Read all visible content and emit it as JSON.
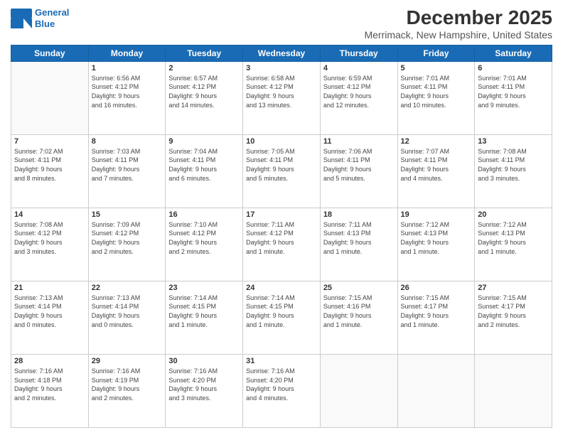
{
  "header": {
    "logo_line1": "General",
    "logo_line2": "Blue",
    "month": "December 2025",
    "location": "Merrimack, New Hampshire, United States"
  },
  "weekdays": [
    "Sunday",
    "Monday",
    "Tuesday",
    "Wednesday",
    "Thursday",
    "Friday",
    "Saturday"
  ],
  "weeks": [
    [
      {
        "day": "",
        "info": ""
      },
      {
        "day": "1",
        "info": "Sunrise: 6:56 AM\nSunset: 4:12 PM\nDaylight: 9 hours\nand 16 minutes."
      },
      {
        "day": "2",
        "info": "Sunrise: 6:57 AM\nSunset: 4:12 PM\nDaylight: 9 hours\nand 14 minutes."
      },
      {
        "day": "3",
        "info": "Sunrise: 6:58 AM\nSunset: 4:12 PM\nDaylight: 9 hours\nand 13 minutes."
      },
      {
        "day": "4",
        "info": "Sunrise: 6:59 AM\nSunset: 4:12 PM\nDaylight: 9 hours\nand 12 minutes."
      },
      {
        "day": "5",
        "info": "Sunrise: 7:01 AM\nSunset: 4:11 PM\nDaylight: 9 hours\nand 10 minutes."
      },
      {
        "day": "6",
        "info": "Sunrise: 7:01 AM\nSunset: 4:11 PM\nDaylight: 9 hours\nand 9 minutes."
      }
    ],
    [
      {
        "day": "7",
        "info": "Sunrise: 7:02 AM\nSunset: 4:11 PM\nDaylight: 9 hours\nand 8 minutes."
      },
      {
        "day": "8",
        "info": "Sunrise: 7:03 AM\nSunset: 4:11 PM\nDaylight: 9 hours\nand 7 minutes."
      },
      {
        "day": "9",
        "info": "Sunrise: 7:04 AM\nSunset: 4:11 PM\nDaylight: 9 hours\nand 6 minutes."
      },
      {
        "day": "10",
        "info": "Sunrise: 7:05 AM\nSunset: 4:11 PM\nDaylight: 9 hours\nand 5 minutes."
      },
      {
        "day": "11",
        "info": "Sunrise: 7:06 AM\nSunset: 4:11 PM\nDaylight: 9 hours\nand 5 minutes."
      },
      {
        "day": "12",
        "info": "Sunrise: 7:07 AM\nSunset: 4:11 PM\nDaylight: 9 hours\nand 4 minutes."
      },
      {
        "day": "13",
        "info": "Sunrise: 7:08 AM\nSunset: 4:11 PM\nDaylight: 9 hours\nand 3 minutes."
      }
    ],
    [
      {
        "day": "14",
        "info": "Sunrise: 7:08 AM\nSunset: 4:12 PM\nDaylight: 9 hours\nand 3 minutes."
      },
      {
        "day": "15",
        "info": "Sunrise: 7:09 AM\nSunset: 4:12 PM\nDaylight: 9 hours\nand 2 minutes."
      },
      {
        "day": "16",
        "info": "Sunrise: 7:10 AM\nSunset: 4:12 PM\nDaylight: 9 hours\nand 2 minutes."
      },
      {
        "day": "17",
        "info": "Sunrise: 7:11 AM\nSunset: 4:12 PM\nDaylight: 9 hours\nand 1 minute."
      },
      {
        "day": "18",
        "info": "Sunrise: 7:11 AM\nSunset: 4:13 PM\nDaylight: 9 hours\nand 1 minute."
      },
      {
        "day": "19",
        "info": "Sunrise: 7:12 AM\nSunset: 4:13 PM\nDaylight: 9 hours\nand 1 minute."
      },
      {
        "day": "20",
        "info": "Sunrise: 7:12 AM\nSunset: 4:13 PM\nDaylight: 9 hours\nand 1 minute."
      }
    ],
    [
      {
        "day": "21",
        "info": "Sunrise: 7:13 AM\nSunset: 4:14 PM\nDaylight: 9 hours\nand 0 minutes."
      },
      {
        "day": "22",
        "info": "Sunrise: 7:13 AM\nSunset: 4:14 PM\nDaylight: 9 hours\nand 0 minutes."
      },
      {
        "day": "23",
        "info": "Sunrise: 7:14 AM\nSunset: 4:15 PM\nDaylight: 9 hours\nand 1 minute."
      },
      {
        "day": "24",
        "info": "Sunrise: 7:14 AM\nSunset: 4:15 PM\nDaylight: 9 hours\nand 1 minute."
      },
      {
        "day": "25",
        "info": "Sunrise: 7:15 AM\nSunset: 4:16 PM\nDaylight: 9 hours\nand 1 minute."
      },
      {
        "day": "26",
        "info": "Sunrise: 7:15 AM\nSunset: 4:17 PM\nDaylight: 9 hours\nand 1 minute."
      },
      {
        "day": "27",
        "info": "Sunrise: 7:15 AM\nSunset: 4:17 PM\nDaylight: 9 hours\nand 2 minutes."
      }
    ],
    [
      {
        "day": "28",
        "info": "Sunrise: 7:16 AM\nSunset: 4:18 PM\nDaylight: 9 hours\nand 2 minutes."
      },
      {
        "day": "29",
        "info": "Sunrise: 7:16 AM\nSunset: 4:19 PM\nDaylight: 9 hours\nand 2 minutes."
      },
      {
        "day": "30",
        "info": "Sunrise: 7:16 AM\nSunset: 4:20 PM\nDaylight: 9 hours\nand 3 minutes."
      },
      {
        "day": "31",
        "info": "Sunrise: 7:16 AM\nSunset: 4:20 PM\nDaylight: 9 hours\nand 4 minutes."
      },
      {
        "day": "",
        "info": ""
      },
      {
        "day": "",
        "info": ""
      },
      {
        "day": "",
        "info": ""
      }
    ]
  ]
}
